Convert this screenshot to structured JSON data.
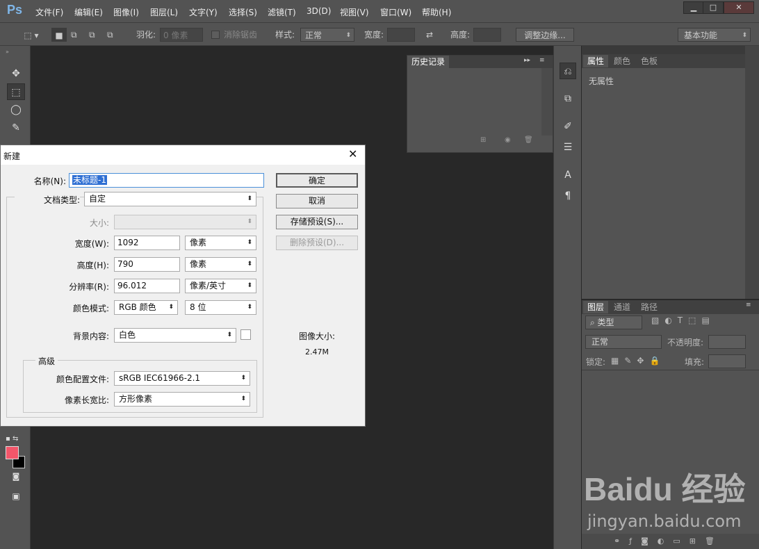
{
  "app": {
    "logo": "Ps"
  },
  "menu": [
    "文件(F)",
    "编辑(E)",
    "图像(I)",
    "图层(L)",
    "文字(Y)",
    "选择(S)",
    "滤镜(T)",
    "3D(D)",
    "视图(V)",
    "窗口(W)",
    "帮助(H)"
  ],
  "window_controls": {
    "minimize": "▁",
    "maximize": "□",
    "close": "✕"
  },
  "options": {
    "feather_label": "羽化:",
    "feather_value": "0 像素",
    "antialias_label": "消除锯齿",
    "style_label": "样式:",
    "style_value": "正常",
    "width_label": "宽度:",
    "height_label": "高度:",
    "refine_button": "调整边缘...",
    "workspace": "基本功能"
  },
  "history_panel": {
    "tab": "历史记录"
  },
  "properties_panel": {
    "tabs": [
      "属性",
      "颜色",
      "色板"
    ],
    "content": "无属性"
  },
  "layers_panel": {
    "tabs": [
      "图层",
      "通道",
      "路径"
    ],
    "filter": "类型",
    "blend": "正常",
    "opacity_label": "不透明度:",
    "lock_label": "锁定:",
    "fill_label": "填充:"
  },
  "colors": {
    "foreground": "#f2566a",
    "background": "#000000",
    "accent": "#7fb6e8"
  },
  "dialog": {
    "title": "新建",
    "name_label": "名称(N):",
    "name_value": "未标题-1",
    "preset_label": "文档类型:",
    "preset_value": "自定",
    "size_label": "大小:",
    "size_value": "",
    "width_label": "宽度(W):",
    "width_value": "1092",
    "width_unit": "像素",
    "height_label": "高度(H):",
    "height_value": "790",
    "height_unit": "像素",
    "res_label": "分辨率(R):",
    "res_value": "96.012",
    "res_unit": "像素/英寸",
    "mode_label": "颜色模式:",
    "mode_value": "RGB 颜色",
    "bit_value": "8 位",
    "bg_label": "背景内容:",
    "bg_value": "白色",
    "advanced_label": "高级",
    "profile_label": "颜色配置文件:",
    "profile_value": "sRGB IEC61966-2.1",
    "aspect_label": "像素长宽比:",
    "aspect_value": "方形像素",
    "ok": "确定",
    "cancel": "取消",
    "save_preset": "存储预设(S)...",
    "delete_preset": "删除预设(D)...",
    "image_size_label": "图像大小:",
    "image_size_value": "2.47M"
  },
  "watermark": {
    "brand": "Baidu 经验",
    "url": "jingyan.baidu.com"
  }
}
